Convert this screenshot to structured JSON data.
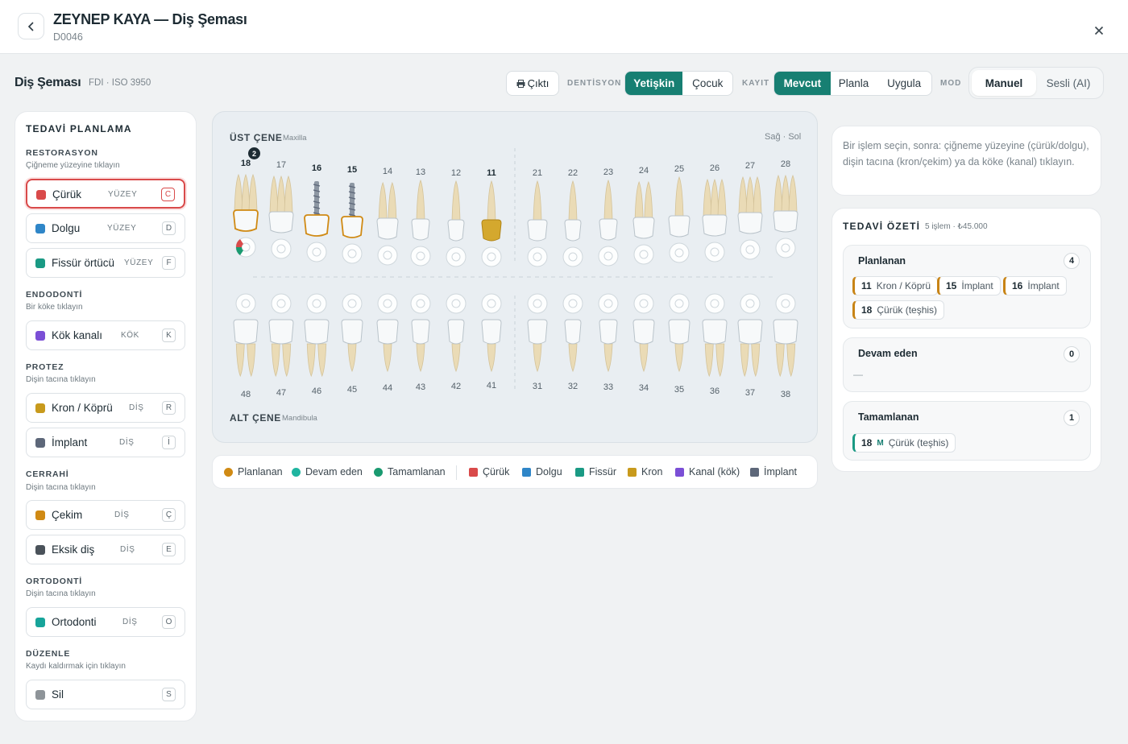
{
  "header": {
    "title": "ZEYNEP KAYA — Diş Şeması",
    "patient_id": "D0046"
  },
  "toolbar": {
    "title": "Diş Şeması",
    "subtitle": "FDI · ISO 3950",
    "print_label": "Çıktı",
    "dentition_label": "DENTİSYON",
    "dentition_options": [
      "Yetişkin",
      "Çocuk"
    ],
    "record_label": "KAYIT",
    "record_options": [
      "Mevcut",
      "Planla",
      "Uygula"
    ],
    "mode_label": "MOD",
    "mode_options": [
      "Manuel",
      "Sesli (AI)"
    ]
  },
  "planning": {
    "title": "TEDAVİ PLANLAMA",
    "groups": [
      {
        "title": "RESTORASYON",
        "subtitle": "Çiğneme yüzeyine tıklayın",
        "tools": [
          {
            "name": "Çürük",
            "tag": "YÜZEY",
            "key": "C",
            "color": "#d94a4a"
          },
          {
            "name": "Dolgu",
            "tag": "YÜZEY",
            "key": "D",
            "color": "#2f86c8"
          },
          {
            "name": "Fissür örtücü",
            "tag": "YÜZEY",
            "key": "F",
            "color": "#1a9a84"
          }
        ]
      },
      {
        "title": "ENDODONTİ",
        "subtitle": "Bir köke tıklayın",
        "tools": [
          {
            "name": "Kök kanalı",
            "tag": "KÖK",
            "key": "K",
            "color": "#7b4fd6"
          }
        ]
      },
      {
        "title": "PROTEZ",
        "subtitle": "Dişin tacına tıklayın",
        "tools": [
          {
            "name": "Kron / Köprü",
            "tag": "DİŞ",
            "key": "R",
            "color": "#c89a1c"
          },
          {
            "name": "İmplant",
            "tag": "DİŞ",
            "key": "İ",
            "color": "#5d6779"
          }
        ]
      },
      {
        "title": "CERRAHİ",
        "subtitle": "Dişin tacına tıklayın",
        "tools": [
          {
            "name": "Çekim",
            "tag": "DİŞ",
            "key": "Ç",
            "color": "#d08a14"
          },
          {
            "name": "Eksik diş",
            "tag": "DİŞ",
            "key": "E",
            "color": "#4a525a"
          }
        ]
      },
      {
        "title": "ORTODONTİ",
        "subtitle": "Dişin tacına tıklayın",
        "tools": [
          {
            "name": "Ortodonti",
            "tag": "DİŞ",
            "key": "O",
            "color": "#17a49a"
          }
        ]
      },
      {
        "title": "DÜZENLE",
        "subtitle": "Kaydı kaldırmak için tıklayın",
        "tools": [
          {
            "name": "Sil",
            "tag": "",
            "key": "S",
            "color": "#8e9499"
          }
        ]
      }
    ]
  },
  "chart": {
    "upper_label": "ÜST ÇENE",
    "upper_sub": "Maxilla",
    "lower_label": "ALT ÇENE",
    "lower_sub": "Mandibula",
    "side": "Sağ · Sol",
    "upper_teeth": [
      "18",
      "17",
      "16",
      "15",
      "14",
      "13",
      "12",
      "11",
      "21",
      "22",
      "23",
      "24",
      "25",
      "26",
      "27",
      "28"
    ],
    "lower_teeth": [
      "48",
      "47",
      "46",
      "45",
      "44",
      "43",
      "42",
      "41",
      "31",
      "32",
      "33",
      "34",
      "35",
      "36",
      "37",
      "38"
    ],
    "tooth18_badge": "2"
  },
  "legend": {
    "status": [
      {
        "label": "Planlanan",
        "color": "#d08a14"
      },
      {
        "label": "Devam eden",
        "color": "#1fb5a0"
      },
      {
        "label": "Tamamlanan",
        "color": "#1a9a70"
      }
    ],
    "types": [
      {
        "label": "Çürük",
        "color": "#d94a4a"
      },
      {
        "label": "Dolgu",
        "color": "#2f86c8"
      },
      {
        "label": "Fissür",
        "color": "#1a9a84"
      },
      {
        "label": "Kron",
        "color": "#c89a1c"
      },
      {
        "label": "Kanal (kök)",
        "color": "#7b4fd6"
      },
      {
        "label": "İmplant",
        "color": "#5d6779"
      }
    ]
  },
  "info": {
    "text": "Bir işlem seçin, sonra: çiğneme yüzeyine (çürük/dolgu), dişin tacına (kron/çekim) ya da köke (kanal) tıklayın."
  },
  "summary": {
    "title": "TEDAVİ ÖZETİ",
    "meta": "5 işlem · ₺45.000",
    "planned": {
      "title": "Planlanan",
      "count": "4",
      "items": [
        {
          "tooth": "11",
          "label": "Kron / Köprü"
        },
        {
          "tooth": "15",
          "label": "İmplant"
        },
        {
          "tooth": "16",
          "label": "İmplant"
        },
        {
          "tooth": "18",
          "label": "Çürük (teşhis)"
        }
      ]
    },
    "ongoing": {
      "title": "Devam eden",
      "count": "0",
      "empty": "—"
    },
    "completed": {
      "title": "Tamamlanan",
      "count": "1",
      "items": [
        {
          "tooth": "18",
          "marker": "M",
          "label": "Çürük (teşhis)"
        }
      ]
    }
  }
}
